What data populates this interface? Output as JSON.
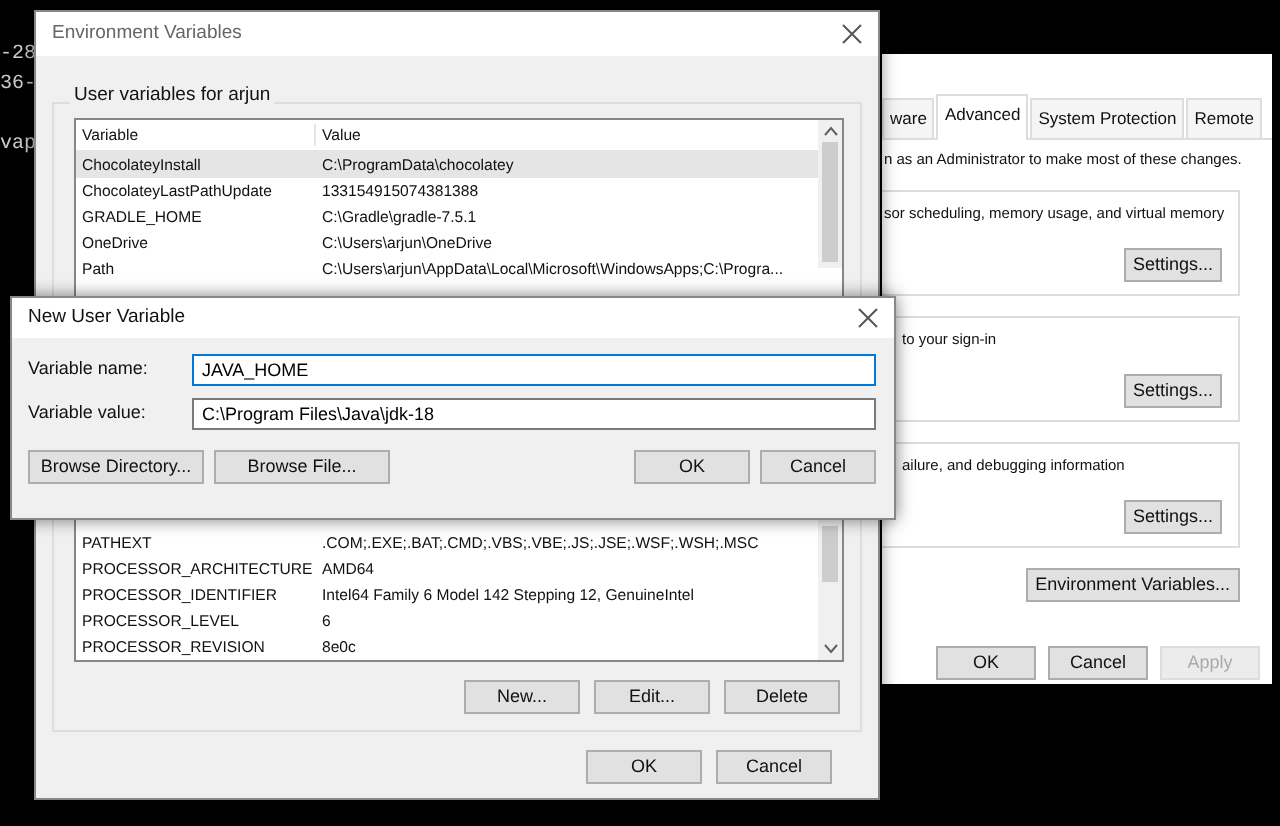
{
  "terminal": {
    "lines": [
      "-28",
      "36-",
      "vap"
    ]
  },
  "system_properties": {
    "tabs": [
      {
        "label": "ware",
        "selected": false
      },
      {
        "label": "Advanced",
        "selected": true
      },
      {
        "label": "System Protection",
        "selected": false
      },
      {
        "label": "Remote",
        "selected": false
      }
    ],
    "intro": "n as an Administrator to make most of these changes.",
    "groups": [
      {
        "text": "sor scheduling, memory usage, and virtual memory",
        "button": "Settings..."
      },
      {
        "text": "to your sign-in",
        "button": "Settings..."
      },
      {
        "text": "ailure, and debugging information",
        "button": "Settings..."
      }
    ],
    "env_button": "Environment Variables...",
    "buttons": [
      {
        "label": "OK",
        "disabled": false
      },
      {
        "label": "Cancel",
        "disabled": false
      },
      {
        "label": "Apply",
        "disabled": true
      }
    ]
  },
  "environment_variables": {
    "title": "Environment Variables",
    "group_label": "User variables for arjun",
    "columns": [
      "Variable",
      "Value"
    ],
    "rows_top": [
      {
        "name": "ChocolateyInstall",
        "value": "C:\\ProgramData\\chocolatey",
        "selected": true
      },
      {
        "name": "ChocolateyLastPathUpdate",
        "value": "133154915074381388",
        "selected": false
      },
      {
        "name": "GRADLE_HOME",
        "value": "C:\\Gradle\\gradle-7.5.1",
        "selected": false
      },
      {
        "name": "OneDrive",
        "value": "C:\\Users\\arjun\\OneDrive",
        "selected": false
      },
      {
        "name": "Path",
        "value": "C:\\Users\\arjun\\AppData\\Local\\Microsoft\\WindowsApps;C:\\Progra...",
        "selected": false
      }
    ],
    "rows_bottom": [
      {
        "name": "PATHEXT",
        "value": ".COM;.EXE;.BAT;.CMD;.VBS;.VBE;.JS;.JSE;.WSF;.WSH;.MSC",
        "selected": false
      },
      {
        "name": "PROCESSOR_ARCHITECTURE",
        "value": "AMD64",
        "selected": false
      },
      {
        "name": "PROCESSOR_IDENTIFIER",
        "value": "Intel64 Family 6 Model 142 Stepping 12, GenuineIntel",
        "selected": false
      },
      {
        "name": "PROCESSOR_LEVEL",
        "value": "6",
        "selected": false
      },
      {
        "name": "PROCESSOR_REVISION",
        "value": "8e0c",
        "selected": false
      }
    ],
    "list_buttons": [
      "New...",
      "Edit...",
      "Delete"
    ],
    "buttons": [
      "OK",
      "Cancel"
    ]
  },
  "new_user_variable": {
    "title": "New User Variable",
    "fields": [
      {
        "label": "Variable name:",
        "value": "JAVA_HOME",
        "focused": true
      },
      {
        "label": "Variable value:",
        "value": "C:\\Program Files\\Java\\jdk-18",
        "focused": false
      }
    ],
    "browse_buttons": [
      "Browse Directory...",
      "Browse File..."
    ],
    "buttons": [
      "OK",
      "Cancel"
    ]
  }
}
